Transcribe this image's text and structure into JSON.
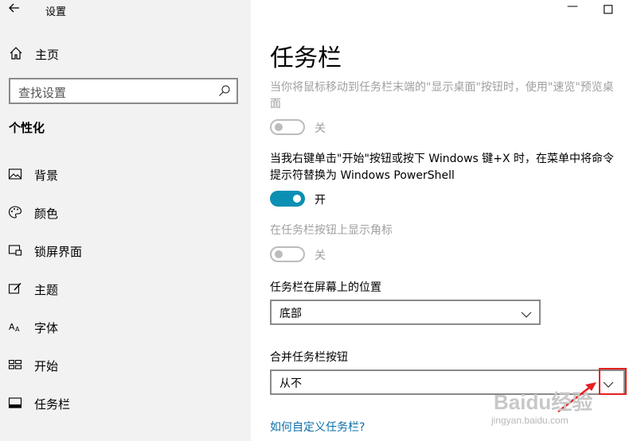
{
  "window": {
    "title": "设置",
    "minimize_glyph": "—",
    "back_icon": "back-arrow-icon"
  },
  "sidebar": {
    "home_label": "主页",
    "search_placeholder": "查找设置",
    "section_title": "个性化",
    "items": [
      {
        "label": "背景",
        "icon": "picture-icon"
      },
      {
        "label": "颜色",
        "icon": "palette-icon"
      },
      {
        "label": "锁屏界面",
        "icon": "lock-screen-icon"
      },
      {
        "label": "主题",
        "icon": "brush-icon"
      },
      {
        "label": "字体",
        "icon": "font-icon"
      },
      {
        "label": "开始",
        "icon": "start-icon"
      },
      {
        "label": "任务栏",
        "icon": "taskbar-icon"
      }
    ]
  },
  "main": {
    "title": "任务栏",
    "settings": [
      {
        "text": "当你将鼠标移动到任务栏末端的\"显示桌面\"按钮时，使用\"速览\"预览桌面",
        "state": "关",
        "on": false,
        "disabled": true
      },
      {
        "text": "当我右键单击\"开始\"按钮或按下 Windows 键+X 时，在菜单中将命令提示符替换为 Windows PowerShell",
        "state": "开",
        "on": true,
        "disabled": false
      },
      {
        "text": "在任务栏按钮上显示角标",
        "state": "关",
        "on": false,
        "disabled": true
      }
    ],
    "position": {
      "label": "任务栏在屏幕上的位置",
      "value": "底部"
    },
    "combine": {
      "label": "合并任务栏按钮",
      "value": "从不"
    },
    "link": "如何自定义任务栏?"
  },
  "watermark": {
    "brand": "Baidu经验",
    "sub": "jingyan.baidu.com"
  },
  "colors": {
    "accent": "#0b8fb3",
    "link": "#0b6fa8",
    "highlight": "#e62020"
  }
}
